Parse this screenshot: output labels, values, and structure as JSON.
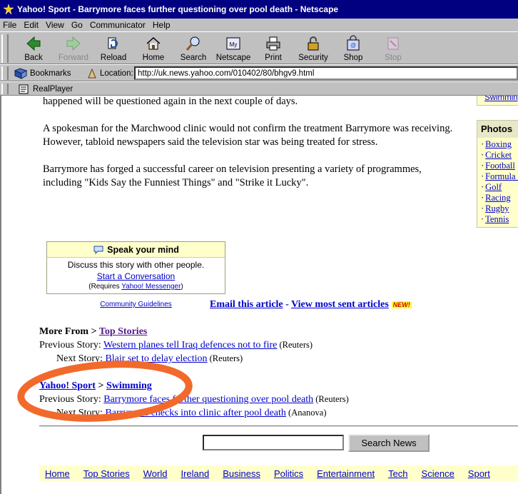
{
  "window": {
    "title": "Yahoo! Sport - Barrymore faces further questioning over pool death - Netscape"
  },
  "menu": [
    "File",
    "Edit",
    "View",
    "Go",
    "Communicator",
    "Help"
  ],
  "toolbar": {
    "back": "Back",
    "forward": "Forward",
    "reload": "Reload",
    "home": "Home",
    "search": "Search",
    "netscape": "Netscape",
    "print": "Print",
    "security": "Security",
    "shop": "Shop",
    "stop": "Stop"
  },
  "location": {
    "bookmarks": "Bookmarks",
    "label": "Location:",
    "url": "http://uk.news.yahoo.com/010402/80/bhgv9.html"
  },
  "personal": {
    "realplayer": "RealPlayer"
  },
  "article": {
    "p0": "happened will be questioned again in the next couple of days.",
    "p1a": "A spokesman for the Marchwood clinic would not confirm the treatment Barrymore was receiving.",
    "p1b": "However, tabloid newspapers said the television star was being treated for stress.",
    "p2a": "Barrymore has forged a successful career on television presenting a variety of programmes,",
    "p2b": "including \"Kids Say the Funniest Things\" and \"Strike it Lucky\"."
  },
  "sidebar": {
    "top_link": "Swimming",
    "photos_title": "Photos",
    "photos": [
      "Boxing",
      "Cricket",
      "Football",
      "Formula One",
      "Golf",
      "Racing",
      "Rugby",
      "Tennis"
    ]
  },
  "speak": {
    "title": "Speak your mind",
    "line1": "Discuss this story with other people.",
    "start": "Start a Conversation",
    "req_pre": "(Requires ",
    "req_link": "Yahoo! Messenger",
    "req_post": ")",
    "guidelines": "Community Guidelines"
  },
  "email": {
    "email_link": "Email this article",
    "sep": " - ",
    "most_sent": "View most sent articles",
    "new_badge": "NEW!"
  },
  "more_from": {
    "label": "More From > ",
    "link": "Top Stories",
    "prev_label": "Previous Story: ",
    "prev_link": "Western planes tell Iraq defences not to fire",
    "prev_src": " (Reuters)",
    "next_label": "Next Story: ",
    "next_link": "Blair set to delay election",
    "next_src": " (Reuters)"
  },
  "sport_section": {
    "yahoo_sport": "Yahoo! Sport",
    "gt": " > ",
    "swimming": "Swimming",
    "prev_label": "Previous Story: ",
    "prev_link": "Barrymore faces further questioning over pool death",
    "prev_src": " (Reuters)",
    "next_label": "Next Story: ",
    "next_link": "Barrymore checks into clinic after pool death",
    "next_src": " (Ananova)"
  },
  "search": {
    "button": "Search News",
    "value": ""
  },
  "nav": [
    "Home",
    "Top Stories",
    "World",
    "Ireland",
    "Business",
    "Politics",
    "Entertainment",
    "Tech",
    "Science",
    "Sport"
  ],
  "colors": {
    "annotation": "#f26a2b",
    "link": "#0000cc",
    "visited": "#551a8b",
    "highlight": "#ffffcc"
  }
}
